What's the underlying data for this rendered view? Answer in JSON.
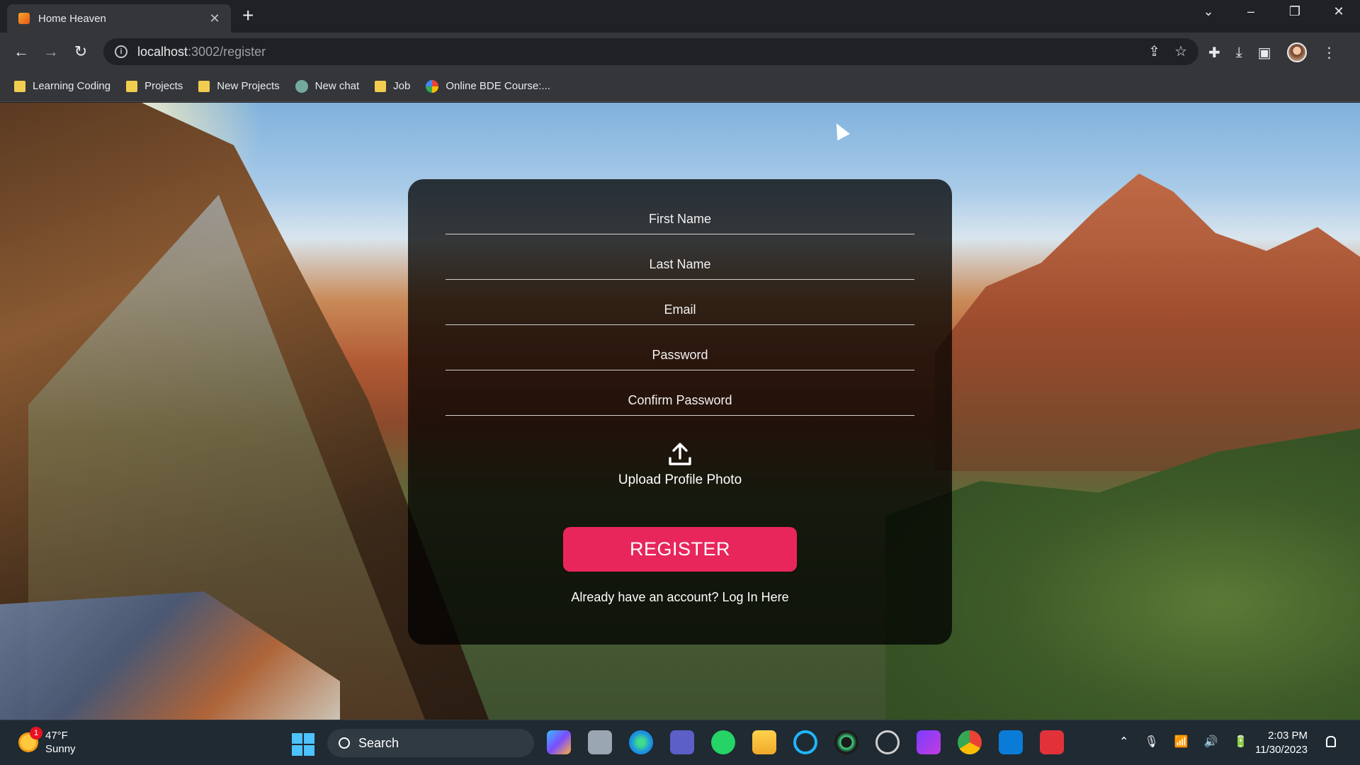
{
  "browser": {
    "tab_title": "Home Heaven",
    "url_host": "localhost",
    "url_path": ":3002/register",
    "bookmarks": [
      {
        "label": "Learning Coding",
        "icon": "folder-icon"
      },
      {
        "label": "Projects",
        "icon": "folder-icon"
      },
      {
        "label": "New Projects",
        "icon": "folder-icon"
      },
      {
        "label": "New chat",
        "icon": "chatgpt-icon"
      },
      {
        "label": "Job",
        "icon": "folder-icon"
      },
      {
        "label": "Online BDE Course:...",
        "icon": "course-icon"
      }
    ]
  },
  "form": {
    "first_name_placeholder": "First Name",
    "last_name_placeholder": "Last Name",
    "email_placeholder": "Email",
    "password_placeholder": "Password",
    "confirm_password_placeholder": "Confirm Password",
    "upload_label": "Upload Profile Photo",
    "register_label": "REGISTER",
    "login_link": "Already have an account? Log In Here"
  },
  "taskbar": {
    "weather_temp": "47°F",
    "weather_desc": "Sunny",
    "weather_badge": "1",
    "search_label": "Search",
    "time": "2:03 PM",
    "date": "11/30/2023"
  },
  "colors": {
    "accent": "#e8265c",
    "card_bg": "rgba(0,0,0,0.76)",
    "chrome_bg": "#35363a"
  }
}
